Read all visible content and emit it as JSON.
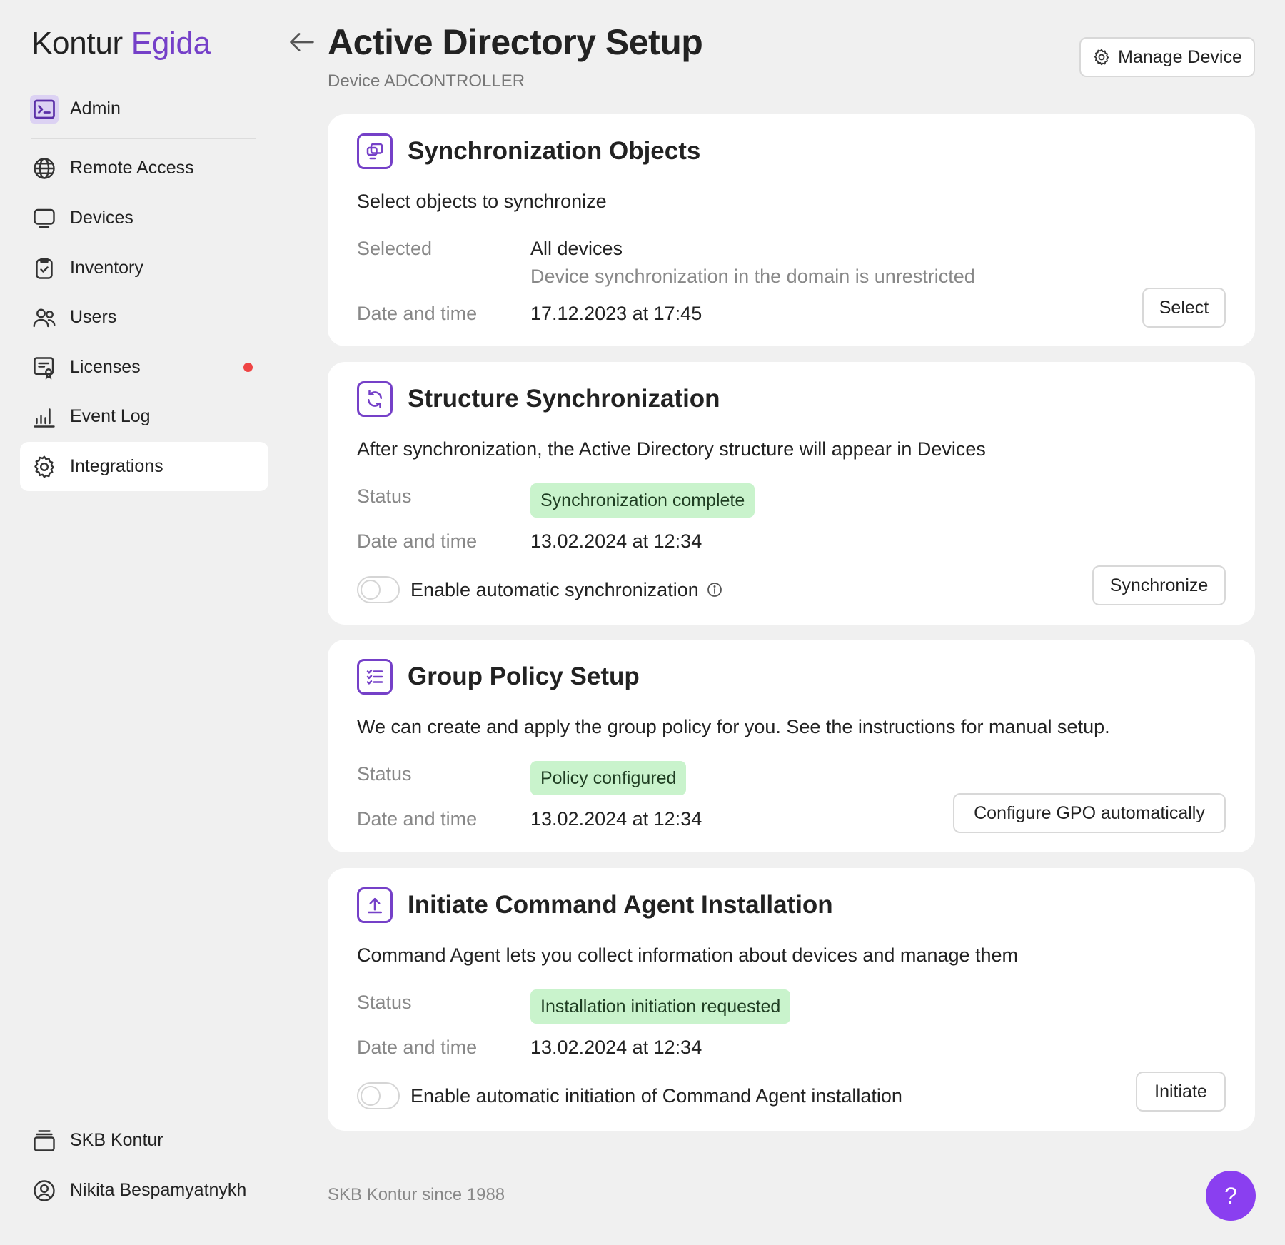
{
  "brand": {
    "part1": "Kontur",
    "part2": "Egida"
  },
  "sidebar": {
    "admin": {
      "label": "Admin",
      "icon": "terminal-icon"
    },
    "items": [
      {
        "label": "Remote Access",
        "icon": "globe-icon"
      },
      {
        "label": "Devices",
        "icon": "monitor-icon"
      },
      {
        "label": "Inventory",
        "icon": "clipboard-check-icon"
      },
      {
        "label": "Users",
        "icon": "users-icon"
      },
      {
        "label": "Licenses",
        "icon": "license-icon",
        "has_notification": true
      },
      {
        "label": "Event Log",
        "icon": "bar-chart-icon"
      },
      {
        "label": "Integrations",
        "icon": "gear-icon",
        "active": true
      }
    ],
    "bottom": [
      {
        "label": "SKB Kontur",
        "icon": "stack-icon"
      },
      {
        "label": "Nikita Bespamyatnykh",
        "icon": "user-circle-icon"
      }
    ]
  },
  "header": {
    "title": "Active Directory Setup",
    "subtitle": "Device ADCONTROLLER",
    "manage_label": "Manage Device"
  },
  "cards": {
    "sync_objects": {
      "title": "Synchronization Objects",
      "description": "Select objects to synchronize",
      "selected_key": "Selected",
      "selected_value": "All devices",
      "selected_note": "Device synchronization in the domain is unrestricted",
      "date_key": "Date and time",
      "date_value": "17.12.2023 at 17:45",
      "button": "Select"
    },
    "structure_sync": {
      "title": "Structure Synchronization",
      "description": "After synchronization, the Active Directory structure will appear in Devices",
      "status_key": "Status",
      "status_value": "Synchronization complete",
      "date_key": "Date and time",
      "date_value": "13.02.2024 at 12:34",
      "toggle_label": "Enable automatic synchronization",
      "toggle_on": false,
      "button": "Synchronize"
    },
    "group_policy": {
      "title": "Group Policy Setup",
      "description": "We can create and apply the group policy for you. See the instructions for manual setup.",
      "status_key": "Status",
      "status_value": "Policy configured",
      "date_key": "Date and time",
      "date_value": "13.02.2024 at 12:34",
      "button": "Configure GPO automatically"
    },
    "agent_install": {
      "title": "Initiate Command Agent Installation",
      "description": "Command Agent lets you collect information about devices and manage them",
      "status_key": "Status",
      "status_value": "Installation initiation requested",
      "date_key": "Date and time",
      "date_value": "13.02.2024 at 12:34",
      "toggle_label": "Enable automatic initiation of Command Agent installation",
      "toggle_on": false,
      "button": "Initiate"
    }
  },
  "footer": {
    "text": "SKB Kontur since 1988"
  },
  "help": {
    "label": "?"
  },
  "colors": {
    "accent": "#7540c8",
    "badge_bg": "#c9f3cc",
    "help_bg": "#8a3ff0",
    "notification": "#ef4444"
  }
}
